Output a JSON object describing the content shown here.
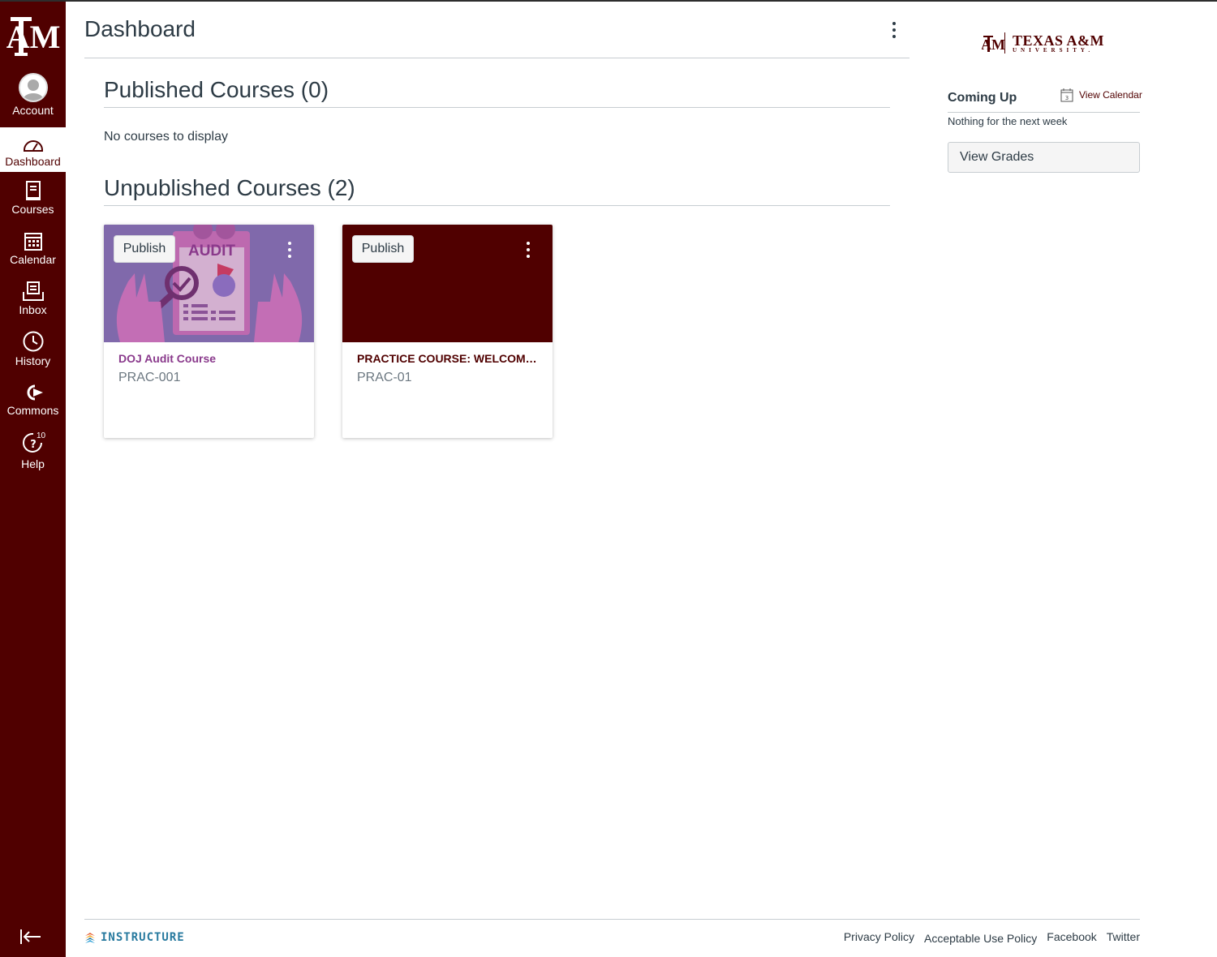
{
  "nav": {
    "items": [
      {
        "label": "Account",
        "icon": "avatar"
      },
      {
        "label": "Dashboard",
        "icon": "dashboard-icon"
      },
      {
        "label": "Courses",
        "icon": "courses-icon"
      },
      {
        "label": "Calendar",
        "icon": "calendar-icon"
      },
      {
        "label": "Inbox",
        "icon": "inbox-icon"
      },
      {
        "label": "History",
        "icon": "history-icon"
      },
      {
        "label": "Commons",
        "icon": "commons-icon"
      },
      {
        "label": "Help",
        "icon": "help-icon",
        "badge": "10"
      }
    ],
    "active": "Dashboard"
  },
  "header": {
    "title": "Dashboard"
  },
  "published": {
    "title": "Published Courses (0)",
    "empty": "No courses to display"
  },
  "unpublished": {
    "title": "Unpublished Courses (2)",
    "cards": [
      {
        "publish_label": "Publish",
        "name": "DOJ Audit Course",
        "code": "PRAC-001",
        "color": "#8a3a8c",
        "hero_text": "AUDIT"
      },
      {
        "publish_label": "Publish",
        "name": "PRACTICE COURSE: WELCOME TO CANVAS",
        "code": "PRAC-01",
        "color": "#500000"
      }
    ]
  },
  "sidebar": {
    "brand": {
      "main": "TEXAS A&M",
      "sub": "UNIVERSITY."
    },
    "coming_up": "Coming Up",
    "view_calendar": "View Calendar",
    "calendar_day": "3",
    "nothing": "Nothing for the next week",
    "view_grades": "View Grades"
  },
  "footer": {
    "brand": "INSTRUCTURE",
    "links": [
      "Privacy Policy",
      "Acceptable Use Policy",
      "Facebook",
      "Twitter"
    ]
  },
  "colors": {
    "maroon": "#500000",
    "link": "#287a9f"
  }
}
